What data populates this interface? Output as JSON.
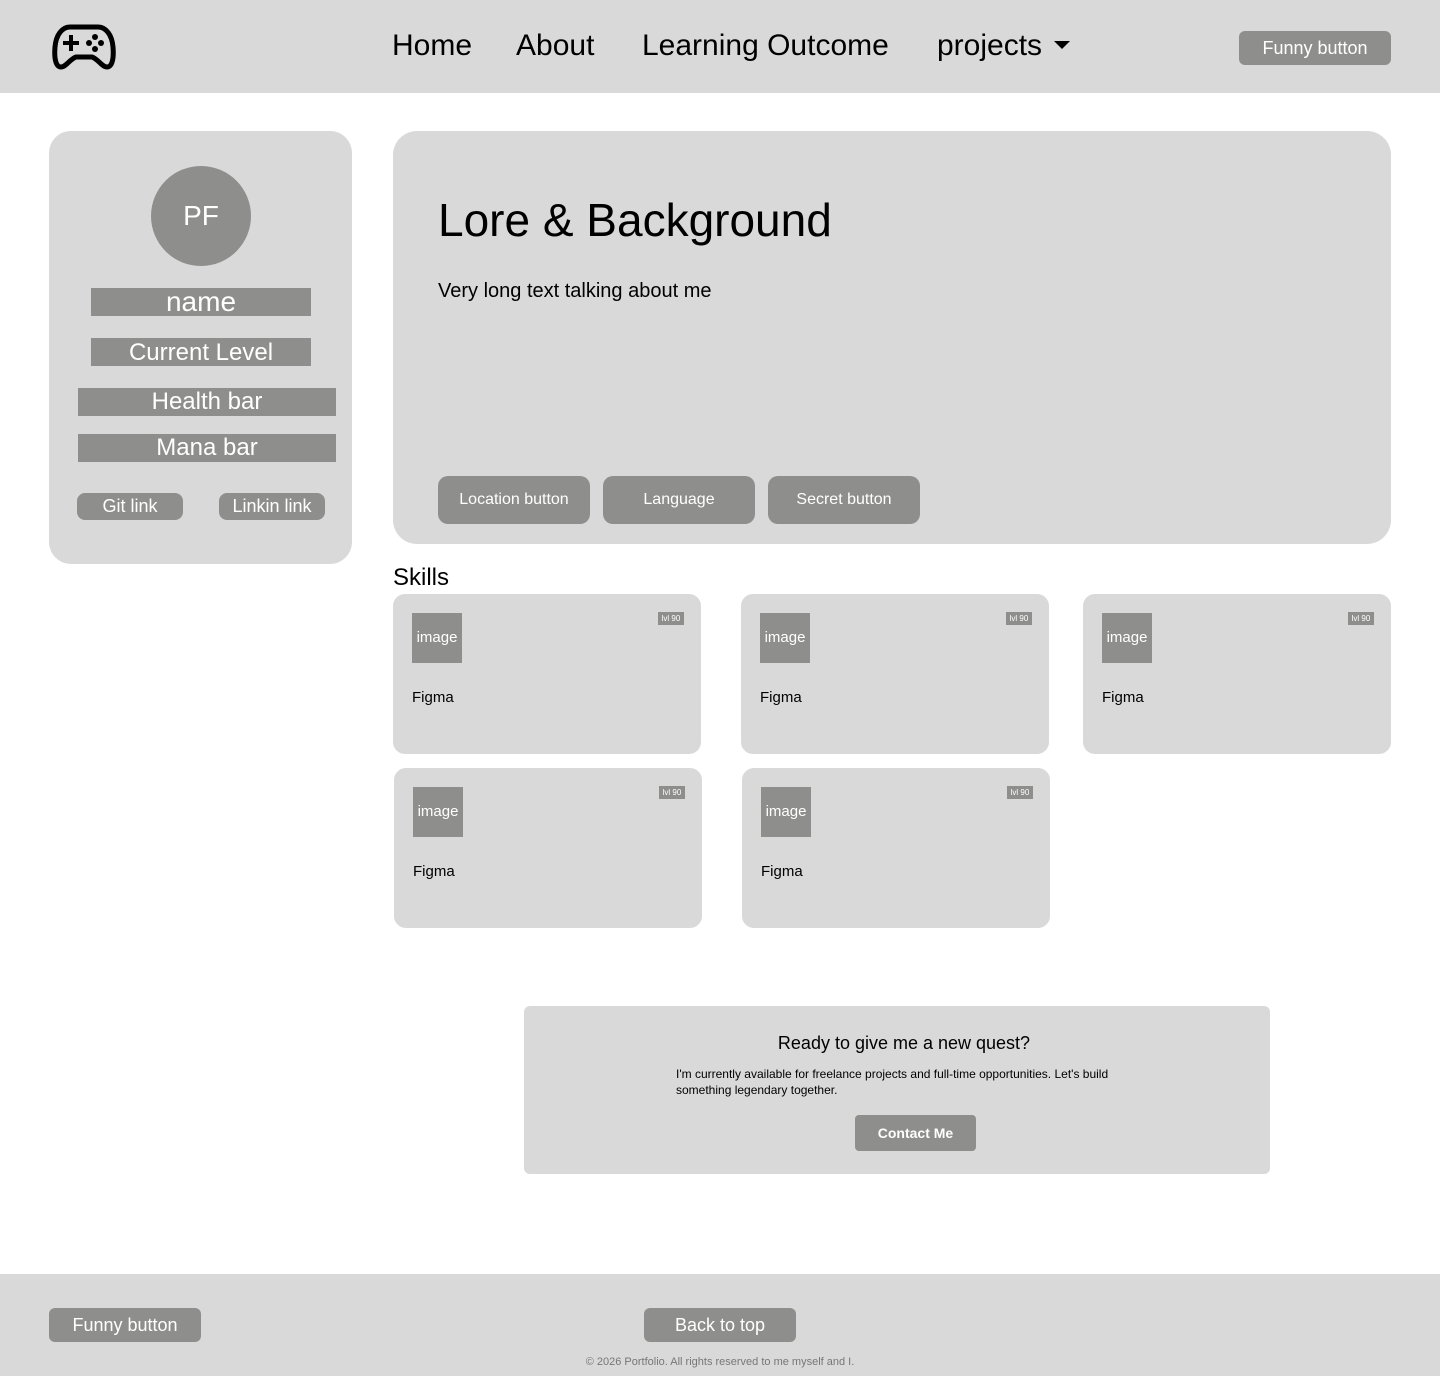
{
  "header": {
    "logo_icon": "gamepad-icon",
    "nav": {
      "home": "Home",
      "about": "About",
      "learning": "Learning Outcome",
      "projects": "projects"
    },
    "funny_button": "Funny button"
  },
  "profile": {
    "initials": "PF",
    "name": "name",
    "level": "Current Level",
    "health": "Health bar",
    "mana": "Mana bar",
    "git": "Git link",
    "linkedin": "Linkin link"
  },
  "lore": {
    "title": "Lore & Background",
    "text": "Very long text talking about me",
    "buttons": [
      "Location button",
      "Language",
      "Secret button"
    ]
  },
  "skills": {
    "title": "Skills",
    "items": [
      {
        "image": "image",
        "level": "lvl 90",
        "name": "Figma"
      },
      {
        "image": "image",
        "level": "lvl 90",
        "name": "Figma"
      },
      {
        "image": "image",
        "level": "lvl 90",
        "name": "Figma"
      },
      {
        "image": "image",
        "level": "lvl 90",
        "name": "Figma"
      },
      {
        "image": "image",
        "level": "lvl 90",
        "name": "Figma"
      }
    ]
  },
  "cta": {
    "title": "Ready to give me a new quest?",
    "text": "I'm currently available for freelance projects and full-time opportunities. Let's build something legendary together.",
    "button": "Contact Me"
  },
  "footer": {
    "funny_button": "Funny button",
    "back_to_top": "Back to top",
    "copyright": "© 2026 Portfolio. All rights reserved to me myself and I."
  },
  "colors": {
    "panel": "#d9d9d9",
    "accent_gray": "#8e8e8c",
    "background": "#ffffff"
  }
}
